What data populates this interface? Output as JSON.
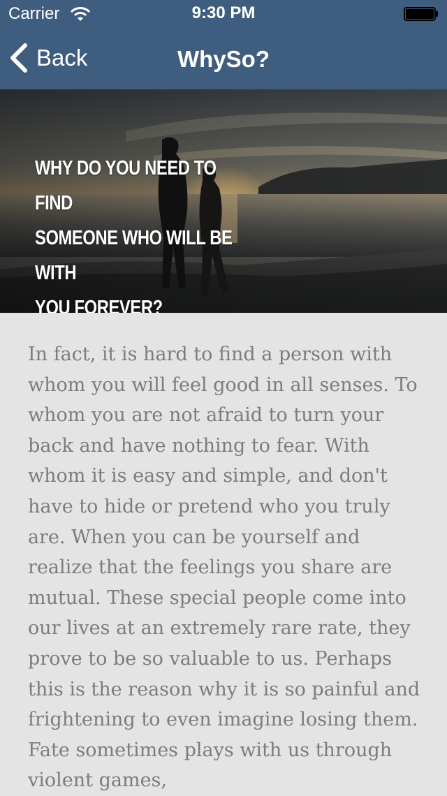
{
  "status_bar": {
    "carrier": "Carrier",
    "time": "9:30 PM",
    "wifi_icon": "wifi-icon",
    "battery_icon": "battery-icon"
  },
  "nav_bar": {
    "back_label": "Back",
    "back_icon": "chevron-left-icon",
    "title": "WhySo?",
    "background": "#3f5e7f"
  },
  "hero": {
    "headline_lines": [
      "WHY DO YOU NEED TO FIND",
      "SOMEONE WHO WILL BE WITH",
      "YOU FOREVER?"
    ],
    "image": "sunset-couple-beach-photo"
  },
  "article": {
    "text": "In fact, it is hard to find a person with whom you will feel good in all senses. To whom you are not afraid to turn your back and have nothing to fear. With whom it is easy and simple, and don't have to hide or pretend who you truly are. When you can be yourself and realize that the feelings you share are mutual. These special people come into our lives at an extremely rare rate, they prove to be so valuable to us. Perhaps this is the reason why it is so painful and frightening to even imagine losing them. Fate sometimes plays with us through violent games,",
    "text_color": "#7c7c7c",
    "background": "#e4e4e4"
  }
}
